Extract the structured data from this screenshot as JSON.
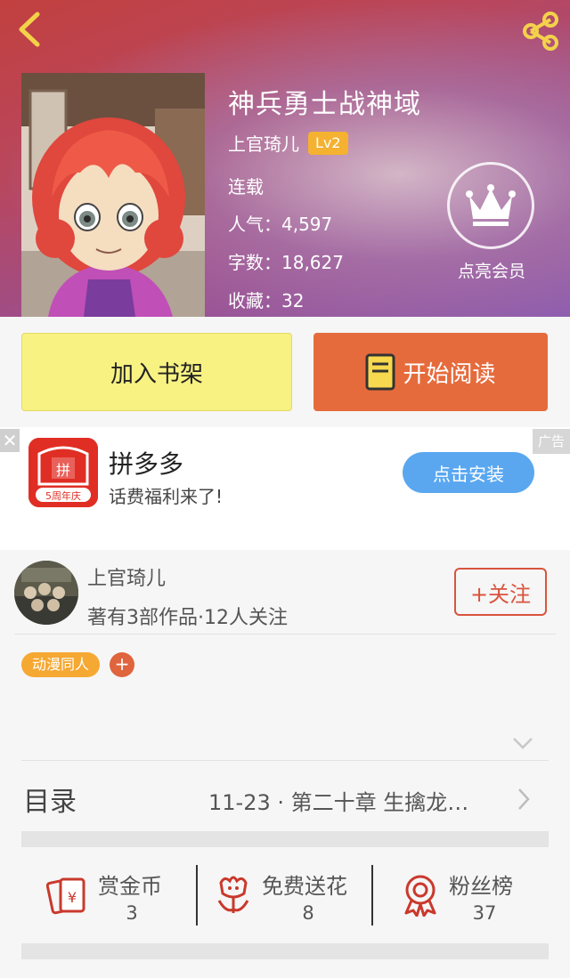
{
  "book": {
    "title": "神兵勇士战神域",
    "author": "上官琦儿",
    "level": "Lv2",
    "status": "连载",
    "popularity": "人气：4,597",
    "word_count": "字数：18,627",
    "favorites": "收藏：32"
  },
  "membership": {
    "label": "点亮会员"
  },
  "actions": {
    "add_shelf": "加入书架",
    "start_reading": "开始阅读"
  },
  "ad": {
    "close": "✕",
    "tag": "广告",
    "app_name": "拼多多",
    "subtitle": "话费福利来了!",
    "install": "点击安装",
    "logo_banner": "5周年庆"
  },
  "author_card": {
    "name": "上官琦儿",
    "stats": "著有3部作品·12人关注",
    "follow": "+关注"
  },
  "tags": {
    "items": [
      "动漫同人"
    ],
    "add": "+"
  },
  "toc": {
    "label": "目录",
    "latest": "11-23 · 第二十章 生擒龙…"
  },
  "stats": [
    {
      "label": "赏金币",
      "value": "3",
      "icon": "red-envelope-icon"
    },
    {
      "label": "免费送花",
      "value": "8",
      "icon": "flower-icon"
    },
    {
      "label": "粉丝榜",
      "value": "37",
      "icon": "award-ribbon-icon"
    }
  ],
  "colors": {
    "accent": "#e66b3c",
    "shelf": "#f8f283",
    "badge": "#f5b130",
    "follow": "#d9543e",
    "install": "#5aa7f0"
  }
}
